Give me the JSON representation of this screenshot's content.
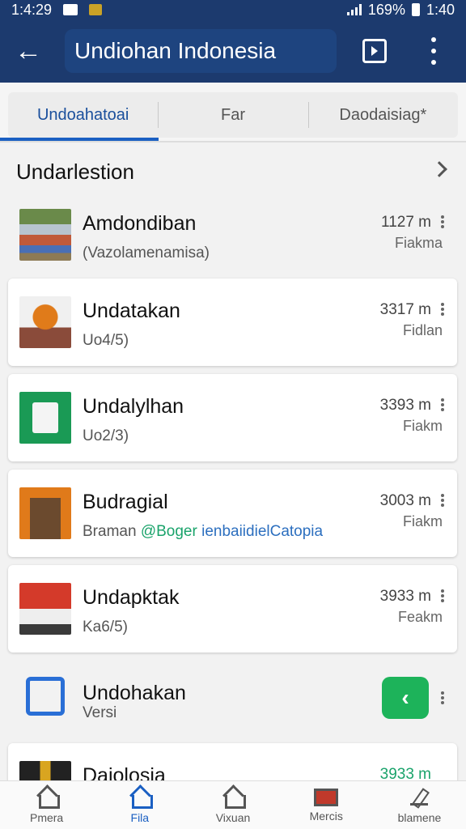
{
  "status_bar": {
    "time": "1:4:29",
    "right_text": "169%",
    "clock_right": "1:40"
  },
  "app_bar": {
    "title": "Undiohan Indonesia",
    "back_icon": "arrow-left-icon",
    "open_icon": "open-box-icon",
    "more_icon": "more-vert-icon"
  },
  "tabs": [
    {
      "label": "Undoahatoai",
      "active": true
    },
    {
      "label": "Far",
      "active": false
    },
    {
      "label": "Daodaisiag*",
      "active": false
    }
  ],
  "section": {
    "title": "Undarlestion"
  },
  "items": [
    {
      "title": "Amdondiban",
      "subtitle": "(Vazolamenamisa)",
      "size": "1127 m",
      "status": "Fiakma"
    },
    {
      "title": "Undatakan",
      "subtitle": "Uo4/5)",
      "size": "3317 m",
      "status": "Fidlan"
    },
    {
      "title": "Undalylhan",
      "subtitle": "Uo2/3)",
      "size": "3393 m",
      "status": "Fiakm"
    },
    {
      "title": "Budragial",
      "subtitle_prefix": "Braman",
      "subtitle_tag": "@Boger",
      "subtitle_link": "ienbaiidielCatopia",
      "size": "3003 m",
      "status": "Fiakm"
    },
    {
      "title": "Undapktak",
      "subtitle": "Ka6/5)",
      "size": "3933 m",
      "status": "Feakm"
    },
    {
      "title": "Undohakan",
      "subtitle": "Versi"
    },
    {
      "title": "Daiolosia",
      "size": "3933 m"
    }
  ],
  "bottom_nav": [
    {
      "label": "Pmera",
      "active": false
    },
    {
      "label": "Fila",
      "active": true
    },
    {
      "label": "Vixuan",
      "active": false
    },
    {
      "label": "Mercis",
      "active": false
    },
    {
      "label": "blamene",
      "active": false
    }
  ],
  "colors": {
    "app_bar": "#1c3a6e",
    "accent": "#1a5fc2",
    "share_button": "#1db35a"
  }
}
